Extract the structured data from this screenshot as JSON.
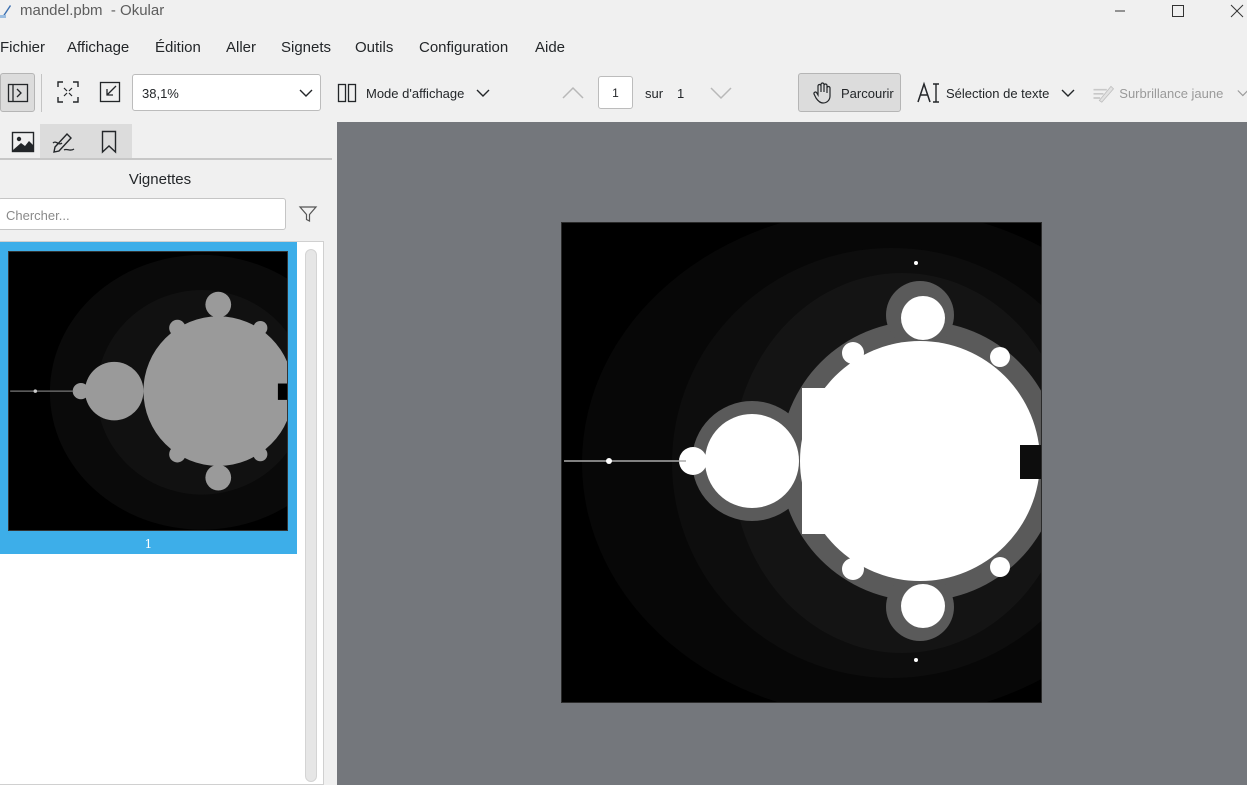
{
  "window": {
    "title": "mandel.pbm  - Okular",
    "controls": {
      "minimize": "minimize-icon",
      "maximize": "maximize-icon",
      "close": "close-icon"
    }
  },
  "menubar": [
    "Fichier",
    "Affichage",
    "Édition",
    "Aller",
    "Signets",
    "Outils",
    "Configuration",
    "Aide"
  ],
  "toolbar": {
    "zoom_value": "38,1%",
    "view_mode_label": "Mode d'affichage",
    "page_current": "1",
    "page_of_label": "sur",
    "page_total": "1",
    "browse_label": "Parcourir",
    "text_select_label": "Sélection de texte",
    "highlight_label": "Surbrillance jaune"
  },
  "sidebar": {
    "tabs": [
      "thumbnails-icon",
      "annotations-icon",
      "bookmarks-icon"
    ],
    "title": "Vignettes",
    "search_placeholder": "Chercher...",
    "thumbnails": [
      {
        "page_label": "1",
        "selected": true
      }
    ]
  },
  "colors": {
    "selection": "#3daee9",
    "viewer_background": "#74777c",
    "window_background": "#f0f0f0"
  }
}
